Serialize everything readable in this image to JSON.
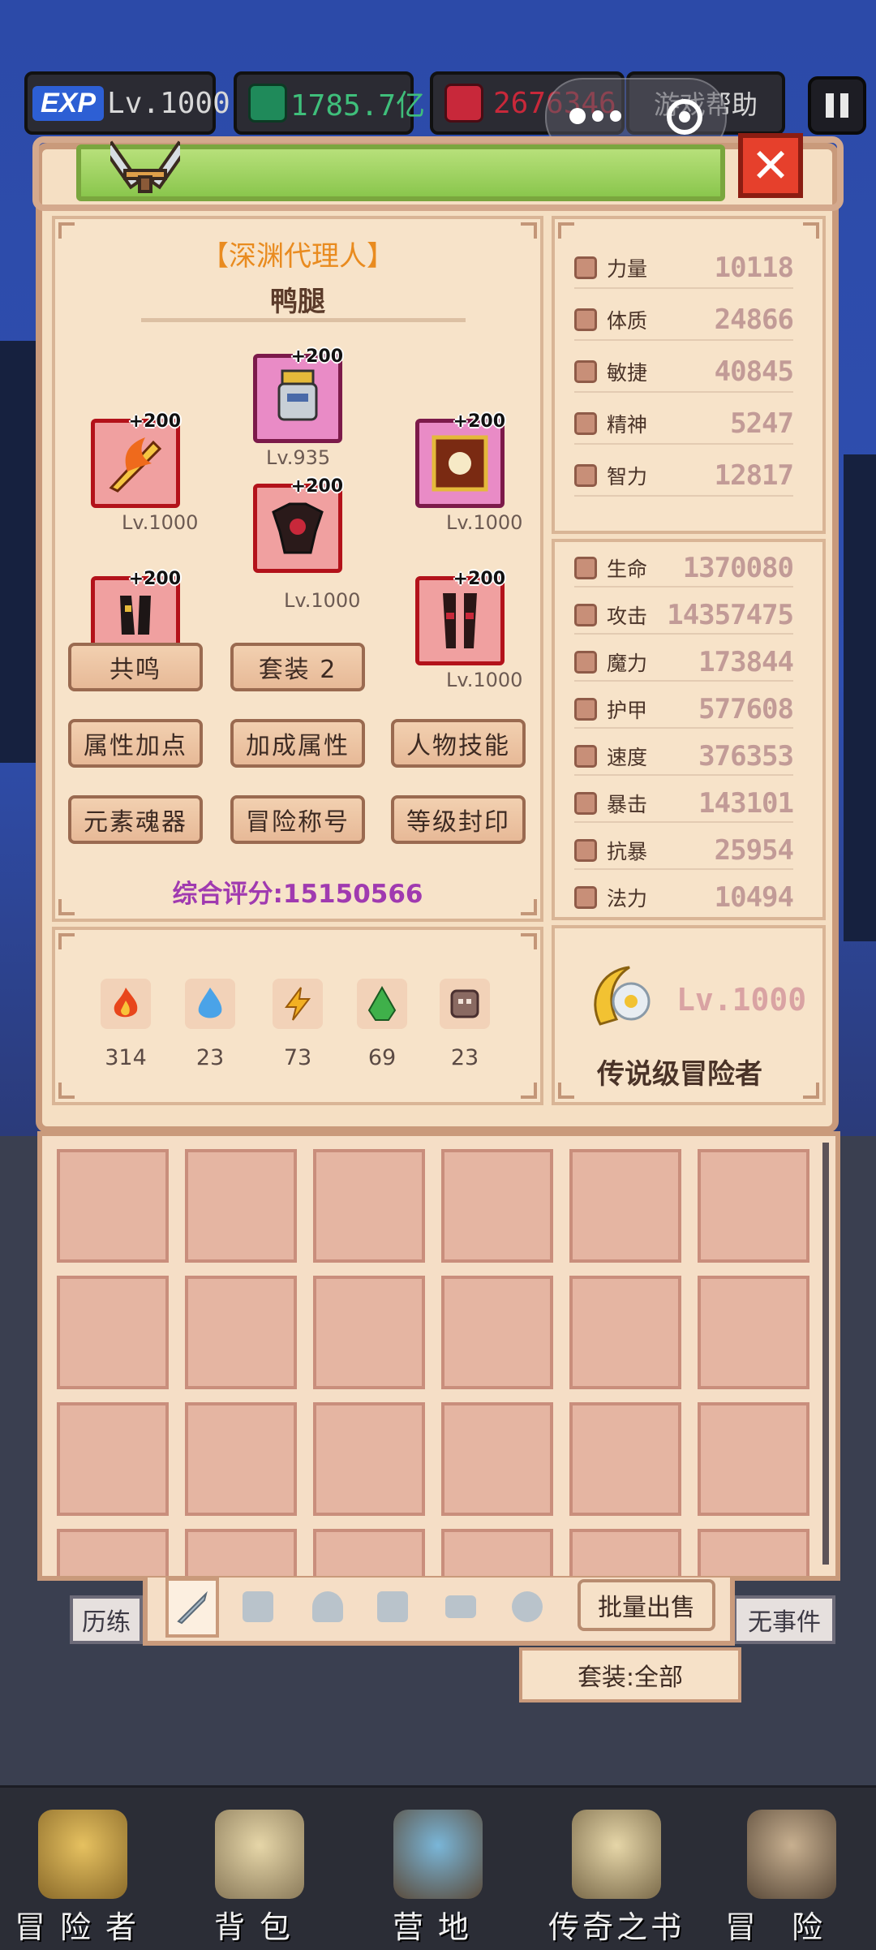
{
  "hud": {
    "exp_badge": "EXP",
    "level": "Lv.1000",
    "green_currency": "1785.7亿",
    "red_currency": "2676346",
    "help_label": "游戏帮助"
  },
  "character": {
    "title": "【深渊代理人】",
    "name": "鸭腿",
    "score": "综合评分:15150566"
  },
  "equipment": [
    {
      "enhance": "+200",
      "level": "Lv.935",
      "name": "helmet-slot"
    },
    {
      "enhance": "+200",
      "level": "Lv.1000",
      "name": "weapon-slot"
    },
    {
      "enhance": "+200",
      "level": "Lv.1000",
      "name": "accessory-slot"
    },
    {
      "enhance": "+200",
      "level": "Lv.1000",
      "name": "armor-slot"
    },
    {
      "enhance": "+200",
      "level": "",
      "name": "gloves-slot"
    },
    {
      "enhance": "+200",
      "level": "Lv.1000",
      "name": "boots-slot"
    }
  ],
  "buttons": {
    "resonance": "共鸣",
    "set_bonus": "套装 2",
    "attr_points": "属性加点",
    "bonus_attr": "加成属性",
    "char_skills": "人物技能",
    "element_soul": "元素魂器",
    "adventure_title": "冒险称号",
    "level_seal": "等级封印"
  },
  "base_stats": [
    {
      "label": "力量",
      "value": "10118"
    },
    {
      "label": "体质",
      "value": "24866"
    },
    {
      "label": "敏捷",
      "value": "40845"
    },
    {
      "label": "精神",
      "value": "5247"
    },
    {
      "label": "智力",
      "value": "12817"
    }
  ],
  "combat_stats": [
    {
      "label": "生命",
      "value": "1370080"
    },
    {
      "label": "攻击",
      "value": "14357475"
    },
    {
      "label": "魔力",
      "value": "173844"
    },
    {
      "label": "护甲",
      "value": "577608"
    },
    {
      "label": "速度",
      "value": "376353"
    },
    {
      "label": "暴击",
      "value": "143101"
    },
    {
      "label": "抗暴",
      "value": "25954"
    },
    {
      "label": "法力",
      "value": "10494"
    }
  ],
  "elements": [
    {
      "icon": "fire-element-icon",
      "value": "314",
      "color": "#e8461c"
    },
    {
      "icon": "water-element-icon",
      "value": "23",
      "color": "#4aa3e8"
    },
    {
      "icon": "lightning-element-icon",
      "value": "73",
      "color": "#f2b022"
    },
    {
      "icon": "earth-element-icon",
      "value": "69",
      "color": "#3fb04a"
    },
    {
      "icon": "dark-element-icon",
      "value": "23",
      "color": "#8a6a62"
    }
  ],
  "legend": {
    "level": "Lv.1000",
    "title": "传说级冒险者"
  },
  "inventory_tabs": [
    "weapon",
    "armor",
    "helmet",
    "gloves",
    "belt",
    "ring"
  ],
  "batch_sell": "批量出售",
  "set_filter": "套装:全部",
  "side_left": "历练",
  "side_right": "无事件",
  "nav": [
    {
      "label": "冒险者",
      "icon": "adventurer-helmet-icon"
    },
    {
      "label": "背包",
      "icon": "backpack-icon"
    },
    {
      "label": "营地",
      "icon": "camp-banner-icon"
    },
    {
      "label": "传奇之书",
      "icon": "legend-book-icon"
    },
    {
      "label": "冒险",
      "icon": "sword-icon"
    }
  ],
  "colors": {
    "accent_orange": "#e98b1f",
    "score_purple": "#a03ab0",
    "stat_value": "#c29b97",
    "panel_bg": "#f5dfc3",
    "close_red": "#e6402c"
  }
}
